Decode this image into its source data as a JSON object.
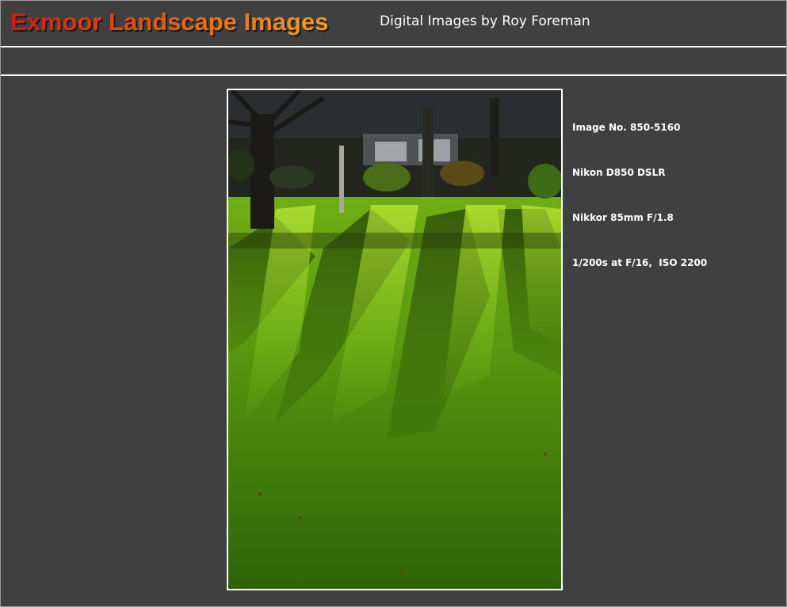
{
  "header": {
    "site_title": "Exmoor Landscape Images",
    "subtitle": "Digital Images by Roy Foreman"
  },
  "photo": {
    "description_icon": "landscape-photo",
    "colors": {
      "grass_light": "#7cc31a",
      "grass_dark": "#2f5e08",
      "trees": "#1b1e14",
      "sky": "#3a3f44"
    }
  },
  "info": {
    "image_no": "Image No. 850-5160",
    "camera": "Nikon D850 DSLR",
    "lens": "Nikkor 85mm F/1.8",
    "exposure": "1/200s at F/16,  ISO 2200"
  }
}
